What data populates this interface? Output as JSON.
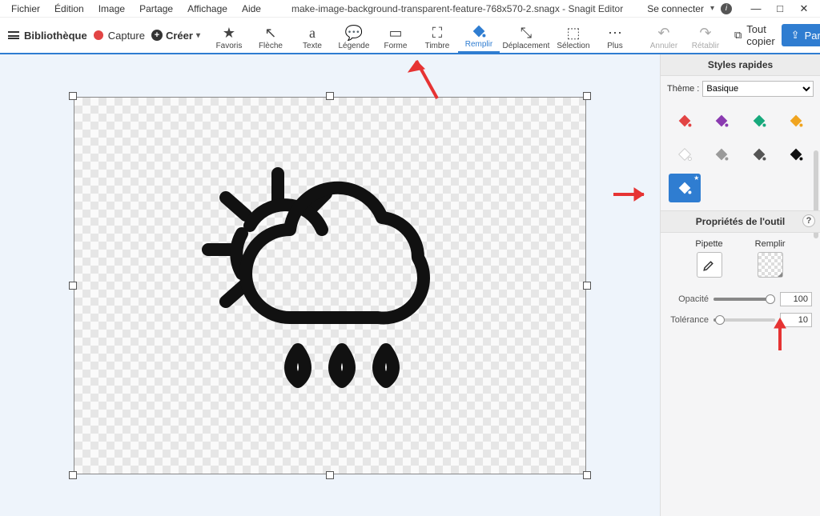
{
  "menubar": {
    "items": [
      "Fichier",
      "Édition",
      "Image",
      "Partage",
      "Affichage",
      "Aide"
    ]
  },
  "title": "make-image-background-transparent-feature-768x570-2.snagx - Snagit Editor",
  "titlebar_right": {
    "signin": "Se connecter"
  },
  "window_controls": {
    "min": "—",
    "max": "□",
    "close": "✕"
  },
  "toolbar_left": {
    "library": "Bibliothèque",
    "capture": "Capture",
    "create": "Créer"
  },
  "tools": {
    "favorites": "Favoris",
    "arrow": "Flèche",
    "text": "Texte",
    "callout": "Légende",
    "shape": "Forme",
    "stamp": "Timbre",
    "fill": "Remplir",
    "move": "Déplacement",
    "selection": "Sélection",
    "more": "Plus",
    "undo": "Annuler",
    "redo": "Rétablir"
  },
  "toolbar_right": {
    "copy_all": "Tout copier",
    "share": "Partage"
  },
  "side": {
    "quick_styles": "Styles rapides",
    "theme_label": "Thème :",
    "theme_value": "Basique",
    "tool_props": "Propriétés de l'outil",
    "pipette": "Pipette",
    "fill": "Remplir",
    "opacity_label": "Opacité",
    "opacity_value": "100",
    "tolerance_label": "Tolérance",
    "tolerance_value": "10"
  },
  "style_colors": [
    "#E24444",
    "#8A3AB0",
    "#17A97C",
    "#F0A41F",
    "#FFFFFF",
    "#9A9A9A",
    "#555555",
    "#111111",
    "#transparent"
  ],
  "canvas_handles": [
    "nw",
    "n",
    "ne",
    "w",
    "e",
    "sw",
    "s",
    "se"
  ]
}
